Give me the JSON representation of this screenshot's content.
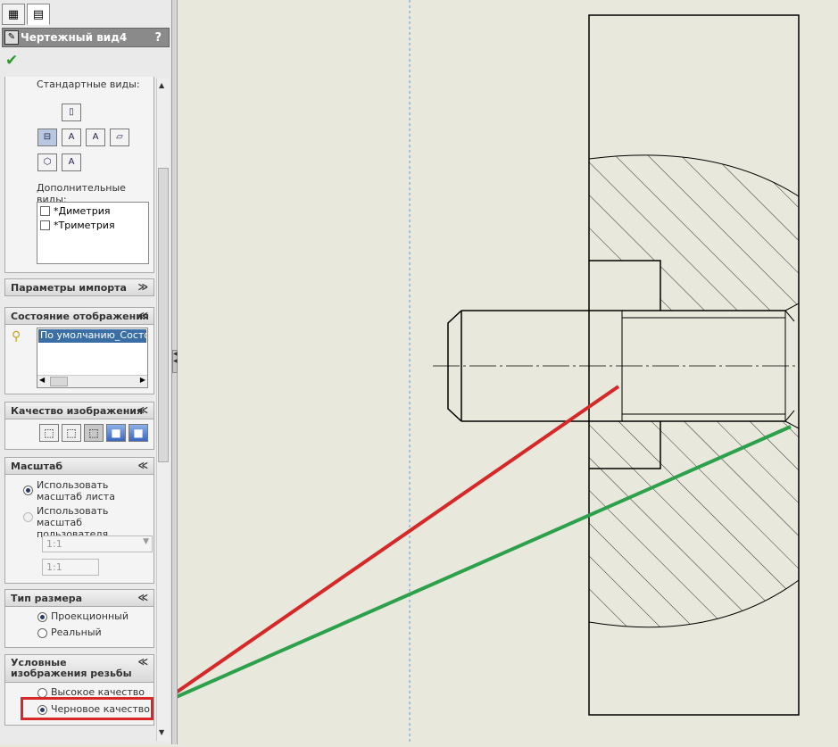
{
  "panel": {
    "title": "Чертежный вид4",
    "help_icon": "?",
    "ok_icon": "✔",
    "sections": {
      "standard_views": {
        "label": "Стандартные виды:"
      },
      "additional_views": {
        "label": "Дополнительные виды:",
        "items": [
          "*Диметрия",
          "*Триметрия"
        ]
      },
      "import_params": {
        "label": "Параметры импорта"
      },
      "display_state": {
        "label": "Состояние отображения",
        "value": "По умолчанию_Состоян"
      },
      "image_quality": {
        "label": "Качество изображения"
      },
      "scale": {
        "label": "Масштаб",
        "options": [
          "Использовать масштаб листа",
          "Использовать масштаб пользователя"
        ],
        "combo_value": "1:1",
        "field_value": "1:1"
      },
      "dim_type": {
        "label": "Тип размера",
        "options": [
          "Проекционный",
          "Реальный"
        ]
      },
      "thread": {
        "label": "Условные изображения резьбы",
        "options": [
          "Высокое качество",
          "Черновое качество"
        ]
      }
    }
  },
  "colors": {
    "highlight_box": "#d62828",
    "red_line": "#d62828",
    "green_line": "#2ca04a"
  },
  "icons": [
    "view-palette-icon",
    "property-manager-icon",
    "drawing-view-icon",
    "checkmark-icon",
    "display-state-icon"
  ]
}
